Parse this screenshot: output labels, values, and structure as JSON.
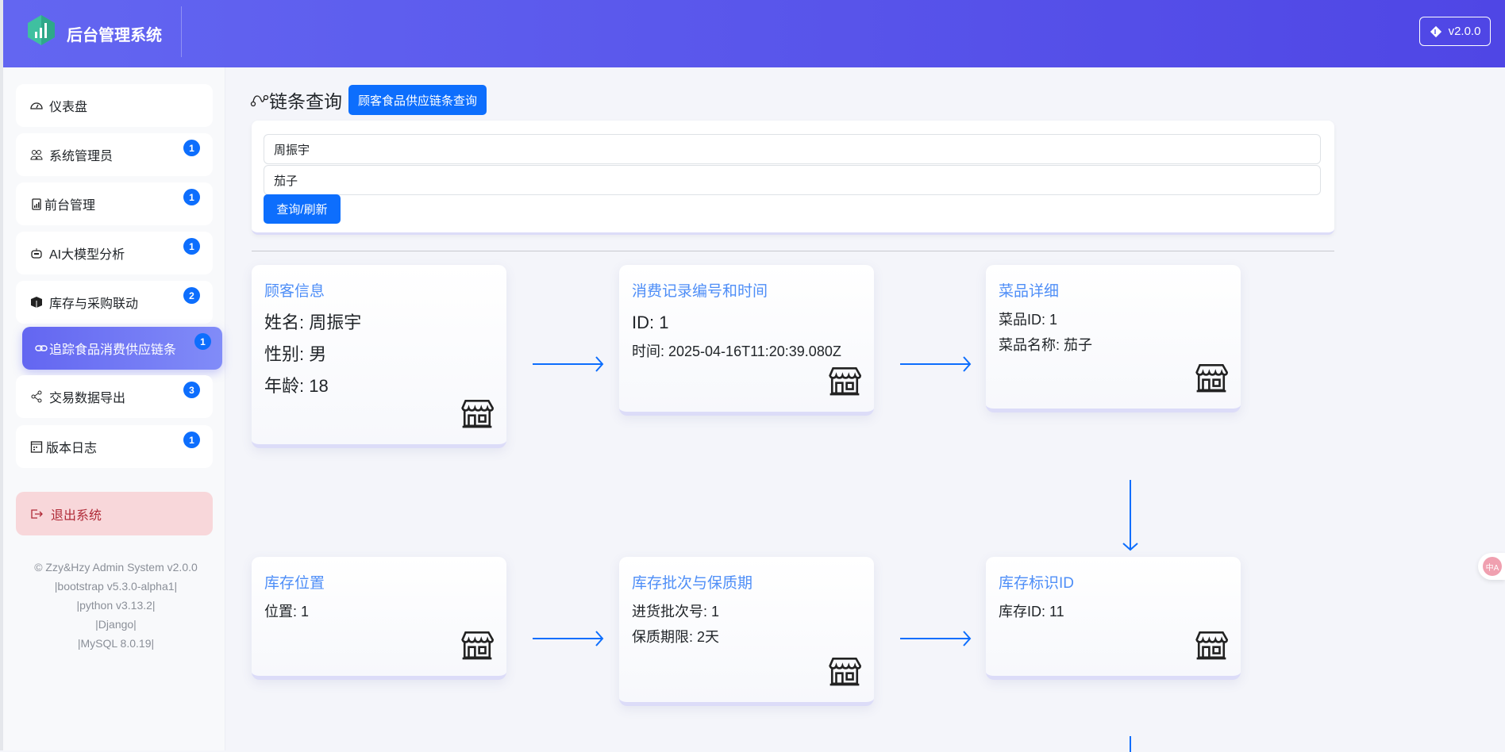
{
  "header": {
    "brand": "后台管理系统",
    "version": "v2.0.0"
  },
  "sidebar": {
    "items": [
      {
        "label": "仪表盘",
        "icon": "speedometer-icon",
        "badge": null
      },
      {
        "label": "系统管理员",
        "icon": "people-icon",
        "badge": "1"
      },
      {
        "label": "前台管理",
        "icon": "clipboard-data-icon",
        "badge": "1"
      },
      {
        "label": "AI大模型分析",
        "icon": "robot-icon",
        "badge": "1"
      },
      {
        "label": "库存与采购联动",
        "icon": "box-icon",
        "badge": "2"
      },
      {
        "label": "追踪食品消费供应链条",
        "icon": "link-icon",
        "badge": "1",
        "active": true
      },
      {
        "label": "交易数据导出",
        "icon": "share-icon",
        "badge": "3"
      },
      {
        "label": "版本日志",
        "icon": "calendar-icon",
        "badge": "1"
      }
    ],
    "logout": "退出系统",
    "footer": [
      "© Zzy&Hzy Admin System v2.0.0",
      "|bootstrap v5.3.0-alpha1|",
      "|python v3.13.2|",
      "|Django|",
      "|MySQL 8.0.19|"
    ]
  },
  "main": {
    "title": "链条查询",
    "title_button": "顾客食品供应链条查询",
    "form": {
      "customer": "周振宇",
      "dish": "茄子",
      "submit": "查询/刷新"
    },
    "cards": [
      {
        "title": "顾客信息",
        "lines": [
          "姓名: 周振宇",
          "性别: 男",
          "年龄: 18"
        ]
      },
      {
        "title": "消费记录编号和时间",
        "lines": [
          "ID: 1",
          "时间: 2025-04-16T11:20:39.080Z"
        ]
      },
      {
        "title": "菜品详细",
        "lines": [
          "菜品ID: 1",
          "菜品名称: 茄子"
        ]
      },
      {
        "title": "库存位置",
        "lines": [
          "位置: 1"
        ]
      },
      {
        "title": "库存批次与保质期",
        "lines": [
          "进货批次号: 1",
          "保质期限: 2天"
        ]
      },
      {
        "title": "库存标识ID",
        "lines": [
          "库存ID: 11"
        ]
      }
    ]
  },
  "colors": {
    "header": "#5b5cf0",
    "accent": "#0d6efd",
    "card_title": "#4e8ef7",
    "logout_bg": "#f8d7da"
  }
}
